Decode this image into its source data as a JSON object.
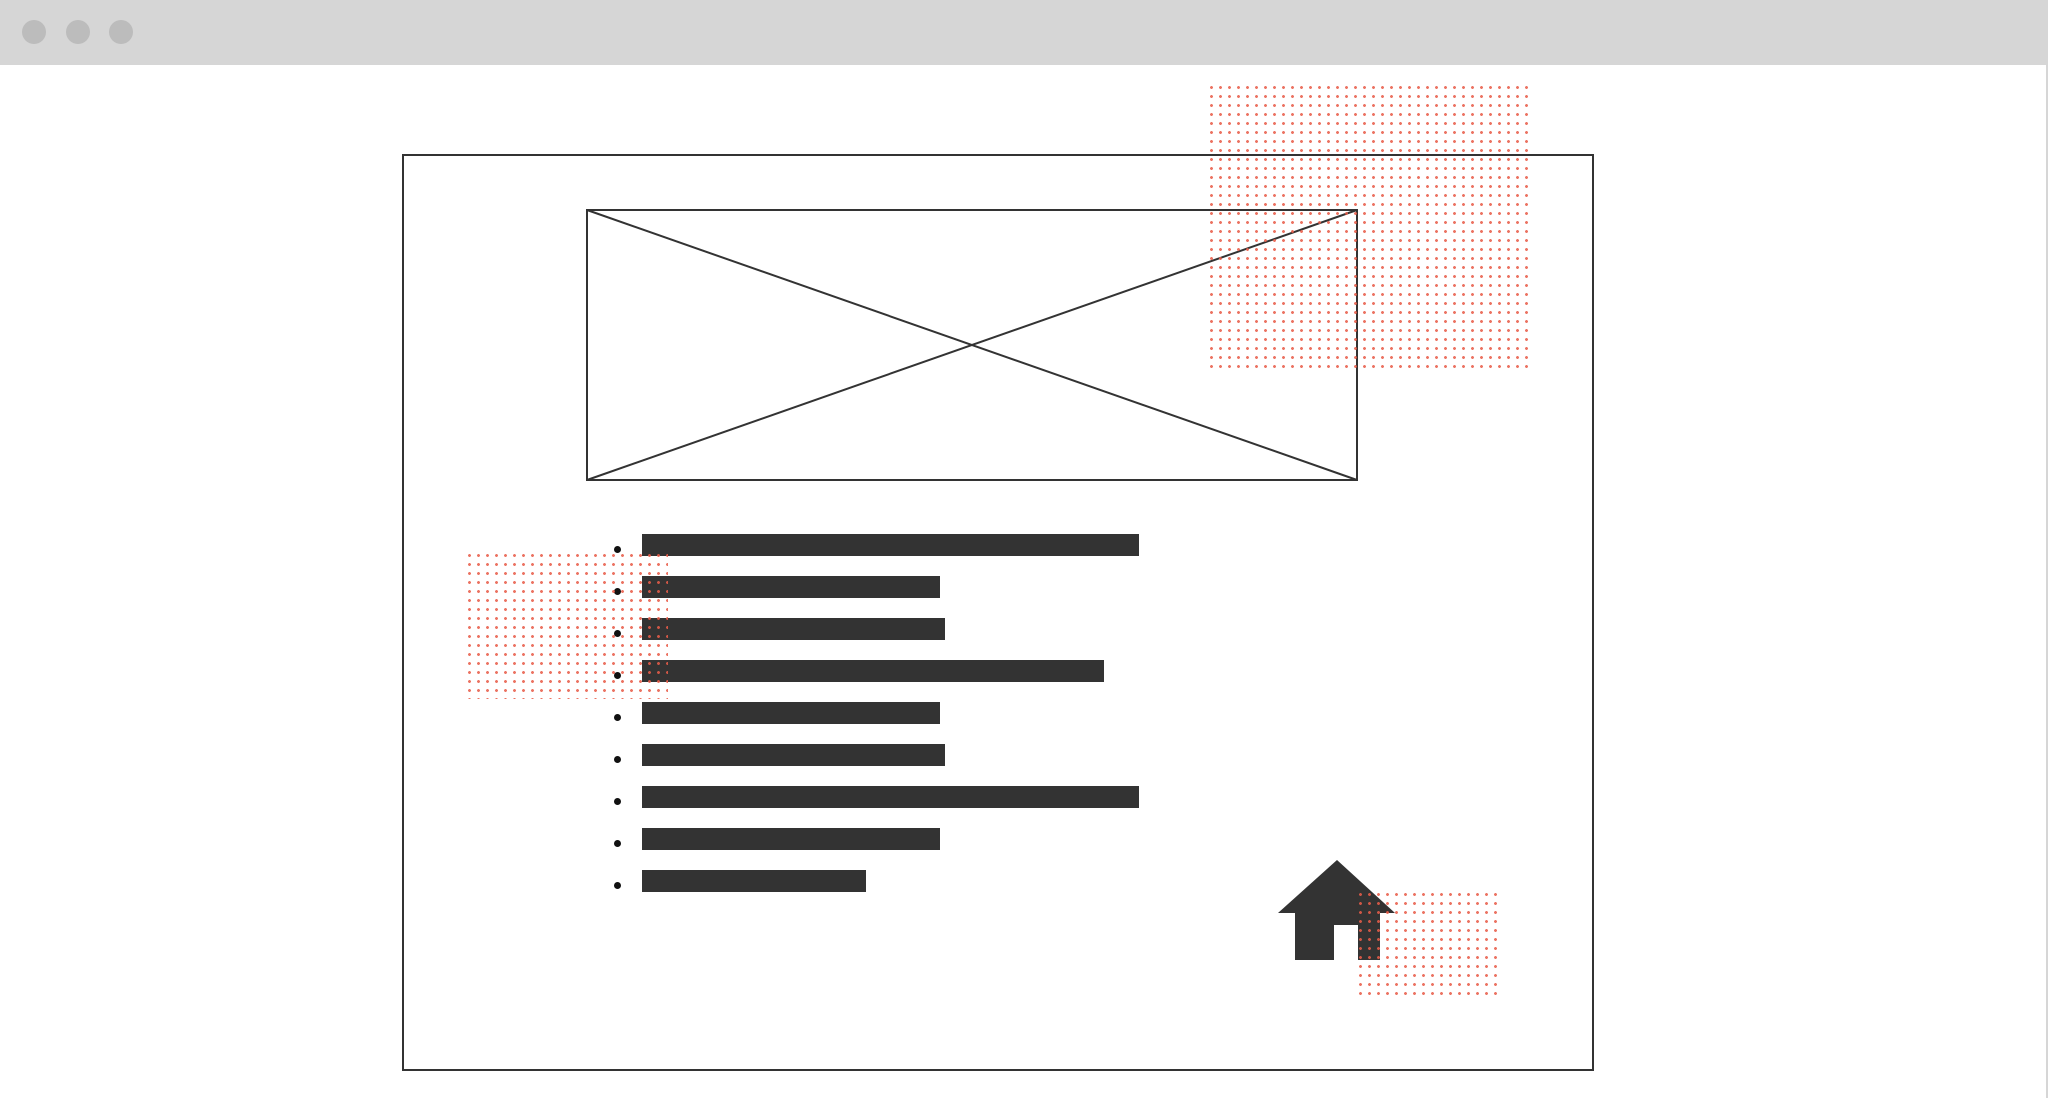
{
  "window": {
    "titlebar_buttons": [
      "close-button",
      "minimize-button",
      "maximize-button"
    ],
    "titlebar_color": "#d6d6d6",
    "dot_color": "#bcbcbc"
  },
  "wireframe": {
    "stroke_color": "#333333",
    "highlight_color": "#e85c48",
    "image_placeholder": "image-placeholder-icon",
    "list_items": [
      {
        "text_fill": 1.0
      },
      {
        "text_fill": 0.6
      },
      {
        "text_fill": 0.61
      },
      {
        "text_fill": 0.93
      },
      {
        "text_fill": 0.6
      },
      {
        "text_fill": 0.61
      },
      {
        "text_fill": 1.0
      },
      {
        "text_fill": 0.6
      },
      {
        "text_fill": 0.45
      }
    ],
    "home_icon": "home-icon"
  }
}
